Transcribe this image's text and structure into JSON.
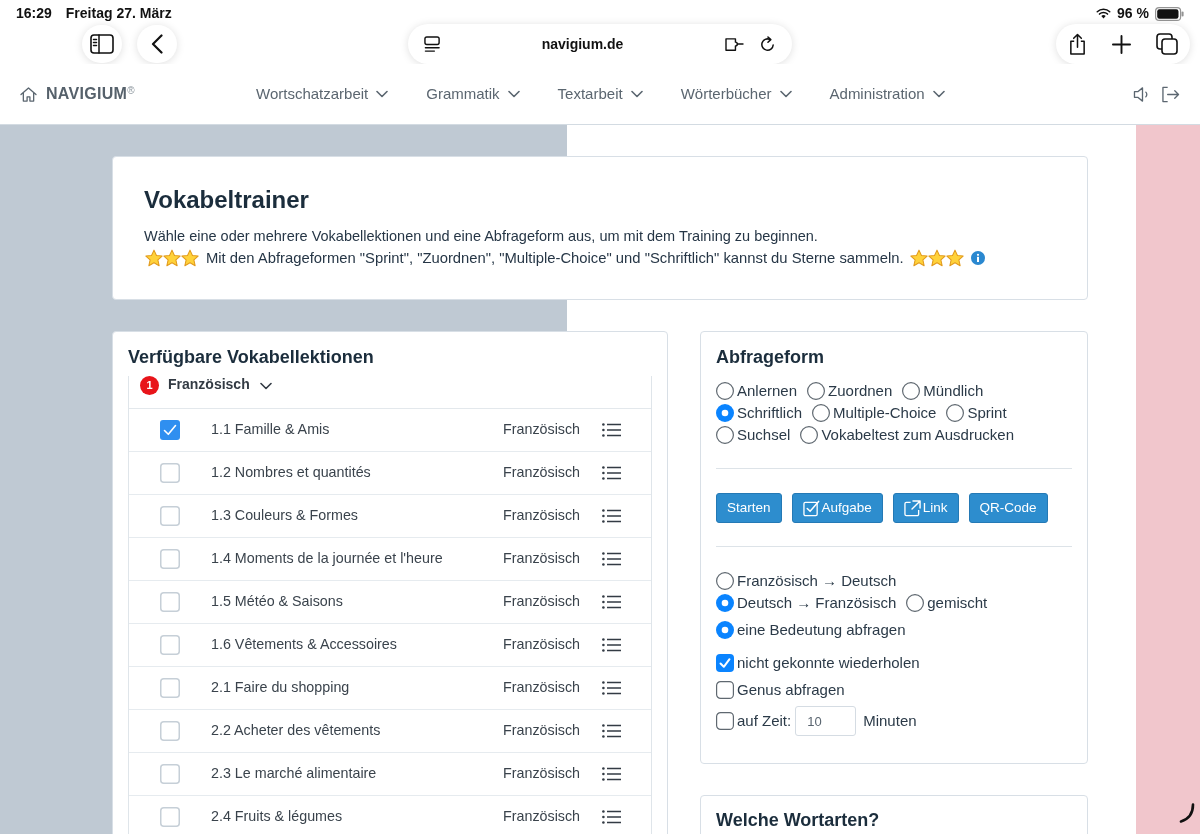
{
  "status_bar": {
    "time": "16:29",
    "date": "Freitag 27. März",
    "battery": "96 %"
  },
  "browser": {
    "url": "navigium.de"
  },
  "nav": {
    "brand": "NAVIGIUM$^{®}$",
    "menus": [
      "Wortschatzarbeit",
      "Grammatik",
      "Textarbeit",
      "Wörterbücher",
      "Administration"
    ]
  },
  "intro": {
    "title": "Vokabeltrainer",
    "lines": [
      "Wähle eine oder mehrere Vokabellektionen und eine Abfrageform aus, um mit dem Training zu beginnen.",
      "Mit den Abfrageformen \"Sprint\", \"Zuordnen\", \"Multiple-Choice\" und \"Schriftlich\" kannst du Sterne sammeln."
    ]
  },
  "lessons": {
    "title": "Verfügbare Vokabellektionen",
    "group": {
      "badge": "1",
      "label": "Französisch",
      "expanded": true
    },
    "rows": [
      {
        "label": "1.1 Famille & Amis",
        "language": "Französisch",
        "checked": true
      },
      {
        "label": "1.2 Nombres et quantités",
        "language": "Französisch",
        "checked": false
      },
      {
        "label": "1.3 Couleurs & Formes",
        "language": "Französisch",
        "checked": false
      },
      {
        "label": "1.4 Moments de la journée et l'heure",
        "language": "Französisch",
        "checked": false
      },
      {
        "label": "1.5 Météo & Saisons",
        "language": "Französisch",
        "checked": false
      },
      {
        "label": "1.6 Vêtements & Accessoires",
        "language": "Französisch",
        "checked": false
      },
      {
        "label": "2.1 Faire du shopping",
        "language": "Französisch",
        "checked": false
      },
      {
        "label": "2.2 Acheter des vêtements",
        "language": "Französisch",
        "checked": false
      },
      {
        "label": "2.3 Le marché alimentaire",
        "language": "Französisch",
        "checked": false
      },
      {
        "label": "2.4 Fruits & légumes",
        "language": "Französisch",
        "checked": false
      }
    ]
  },
  "query_form": {
    "title": "Abfrageform",
    "modes": [
      [
        {
          "label": "Anlernen",
          "selected": false
        },
        {
          "label": "Zuordnen",
          "selected": false
        },
        {
          "label": "Mündlich",
          "selected": false
        }
      ],
      [
        {
          "label": "Schriftlich",
          "selected": true
        },
        {
          "label": "Multiple-Choice",
          "selected": false
        },
        {
          "label": "Sprint",
          "selected": false
        }
      ],
      [
        {
          "label": "Suchsel",
          "selected": false
        },
        {
          "label": "Vokabeltest zum Ausdrucken",
          "selected": false
        }
      ]
    ],
    "buttons": [
      {
        "label": "Starten",
        "kind": "plain"
      },
      {
        "label": "Aufgabe",
        "kind": "task"
      },
      {
        "label": "Link",
        "kind": "link"
      },
      {
        "label": "QR-Code",
        "kind": "plain"
      }
    ],
    "directions": [
      [
        {
          "label": "Französisch → Deutsch",
          "selected": false
        }
      ],
      [
        {
          "label": "Deutsch → Französisch",
          "selected": true
        },
        {
          "label": "gemischt",
          "selected": false
        }
      ]
    ],
    "meaning": {
      "label": "eine Bedeutung abfragen",
      "selected": true
    },
    "options": [
      {
        "kind": "plain",
        "label": "nicht gekonnte wiederholen",
        "checked": true
      },
      {
        "kind": "plain",
        "label": "Genus abfragen",
        "checked": false
      },
      {
        "kind": "timer",
        "label": "auf Zeit:",
        "checked": false,
        "value": "10",
        "unit": "Minuten"
      }
    ]
  },
  "word_types": {
    "title": "Welche Wortarten?"
  }
}
